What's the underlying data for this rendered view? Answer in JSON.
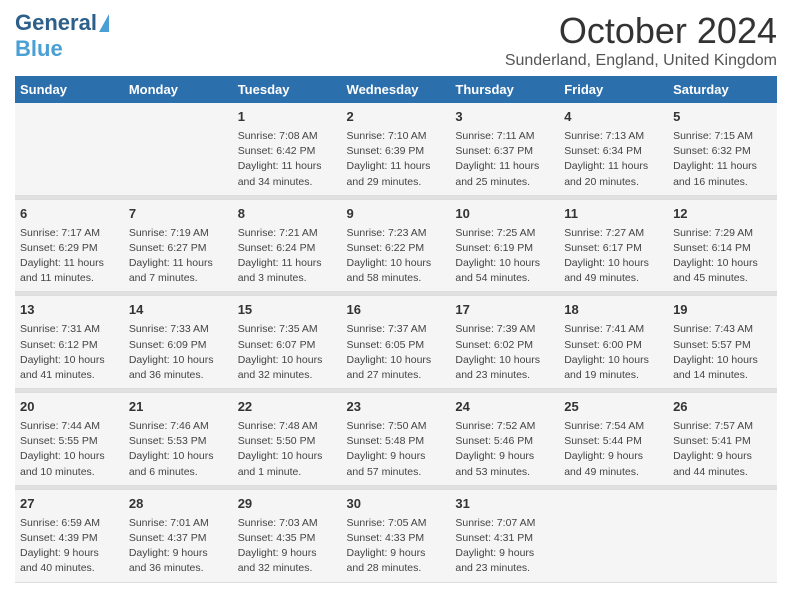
{
  "logo": {
    "general": "General",
    "blue": "Blue"
  },
  "title": "October 2024",
  "location": "Sunderland, England, United Kingdom",
  "days_header": [
    "Sunday",
    "Monday",
    "Tuesday",
    "Wednesday",
    "Thursday",
    "Friday",
    "Saturday"
  ],
  "weeks": [
    [
      {
        "num": "",
        "info": ""
      },
      {
        "num": "",
        "info": ""
      },
      {
        "num": "1",
        "info": "Sunrise: 7:08 AM\nSunset: 6:42 PM\nDaylight: 11 hours and 34 minutes."
      },
      {
        "num": "2",
        "info": "Sunrise: 7:10 AM\nSunset: 6:39 PM\nDaylight: 11 hours and 29 minutes."
      },
      {
        "num": "3",
        "info": "Sunrise: 7:11 AM\nSunset: 6:37 PM\nDaylight: 11 hours and 25 minutes."
      },
      {
        "num": "4",
        "info": "Sunrise: 7:13 AM\nSunset: 6:34 PM\nDaylight: 11 hours and 20 minutes."
      },
      {
        "num": "5",
        "info": "Sunrise: 7:15 AM\nSunset: 6:32 PM\nDaylight: 11 hours and 16 minutes."
      }
    ],
    [
      {
        "num": "6",
        "info": "Sunrise: 7:17 AM\nSunset: 6:29 PM\nDaylight: 11 hours and 11 minutes."
      },
      {
        "num": "7",
        "info": "Sunrise: 7:19 AM\nSunset: 6:27 PM\nDaylight: 11 hours and 7 minutes."
      },
      {
        "num": "8",
        "info": "Sunrise: 7:21 AM\nSunset: 6:24 PM\nDaylight: 11 hours and 3 minutes."
      },
      {
        "num": "9",
        "info": "Sunrise: 7:23 AM\nSunset: 6:22 PM\nDaylight: 10 hours and 58 minutes."
      },
      {
        "num": "10",
        "info": "Sunrise: 7:25 AM\nSunset: 6:19 PM\nDaylight: 10 hours and 54 minutes."
      },
      {
        "num": "11",
        "info": "Sunrise: 7:27 AM\nSunset: 6:17 PM\nDaylight: 10 hours and 49 minutes."
      },
      {
        "num": "12",
        "info": "Sunrise: 7:29 AM\nSunset: 6:14 PM\nDaylight: 10 hours and 45 minutes."
      }
    ],
    [
      {
        "num": "13",
        "info": "Sunrise: 7:31 AM\nSunset: 6:12 PM\nDaylight: 10 hours and 41 minutes."
      },
      {
        "num": "14",
        "info": "Sunrise: 7:33 AM\nSunset: 6:09 PM\nDaylight: 10 hours and 36 minutes."
      },
      {
        "num": "15",
        "info": "Sunrise: 7:35 AM\nSunset: 6:07 PM\nDaylight: 10 hours and 32 minutes."
      },
      {
        "num": "16",
        "info": "Sunrise: 7:37 AM\nSunset: 6:05 PM\nDaylight: 10 hours and 27 minutes."
      },
      {
        "num": "17",
        "info": "Sunrise: 7:39 AM\nSunset: 6:02 PM\nDaylight: 10 hours and 23 minutes."
      },
      {
        "num": "18",
        "info": "Sunrise: 7:41 AM\nSunset: 6:00 PM\nDaylight: 10 hours and 19 minutes."
      },
      {
        "num": "19",
        "info": "Sunrise: 7:43 AM\nSunset: 5:57 PM\nDaylight: 10 hours and 14 minutes."
      }
    ],
    [
      {
        "num": "20",
        "info": "Sunrise: 7:44 AM\nSunset: 5:55 PM\nDaylight: 10 hours and 10 minutes."
      },
      {
        "num": "21",
        "info": "Sunrise: 7:46 AM\nSunset: 5:53 PM\nDaylight: 10 hours and 6 minutes."
      },
      {
        "num": "22",
        "info": "Sunrise: 7:48 AM\nSunset: 5:50 PM\nDaylight: 10 hours and 1 minute."
      },
      {
        "num": "23",
        "info": "Sunrise: 7:50 AM\nSunset: 5:48 PM\nDaylight: 9 hours and 57 minutes."
      },
      {
        "num": "24",
        "info": "Sunrise: 7:52 AM\nSunset: 5:46 PM\nDaylight: 9 hours and 53 minutes."
      },
      {
        "num": "25",
        "info": "Sunrise: 7:54 AM\nSunset: 5:44 PM\nDaylight: 9 hours and 49 minutes."
      },
      {
        "num": "26",
        "info": "Sunrise: 7:57 AM\nSunset: 5:41 PM\nDaylight: 9 hours and 44 minutes."
      }
    ],
    [
      {
        "num": "27",
        "info": "Sunrise: 6:59 AM\nSunset: 4:39 PM\nDaylight: 9 hours and 40 minutes."
      },
      {
        "num": "28",
        "info": "Sunrise: 7:01 AM\nSunset: 4:37 PM\nDaylight: 9 hours and 36 minutes."
      },
      {
        "num": "29",
        "info": "Sunrise: 7:03 AM\nSunset: 4:35 PM\nDaylight: 9 hours and 32 minutes."
      },
      {
        "num": "30",
        "info": "Sunrise: 7:05 AM\nSunset: 4:33 PM\nDaylight: 9 hours and 28 minutes."
      },
      {
        "num": "31",
        "info": "Sunrise: 7:07 AM\nSunset: 4:31 PM\nDaylight: 9 hours and 23 minutes."
      },
      {
        "num": "",
        "info": ""
      },
      {
        "num": "",
        "info": ""
      }
    ]
  ]
}
